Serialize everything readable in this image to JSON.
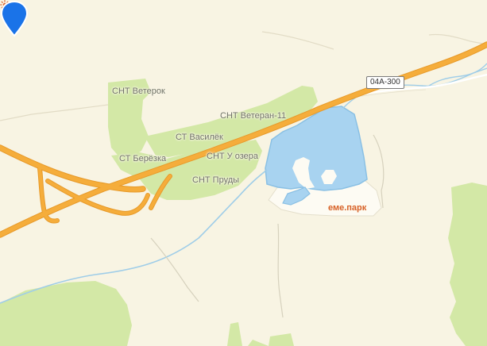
{
  "map": {
    "colors": {
      "land": "#f8f4e3",
      "forest": "#d3e8a6",
      "forest_dark": "#bedf8d",
      "water": "#a8d3f0",
      "water_stroke": "#8ac0e4",
      "stream": "#9fcde8",
      "highway": "#f5ad3b",
      "highway_casing": "#e79a2a",
      "minor_road": "#ffffff",
      "track": "#d6d1bd",
      "pin": "#1a73e8",
      "poi_accent": "#d8622a"
    },
    "road_shield": "04А-300",
    "labels": {
      "snt_veterok": "СНТ Ветерок",
      "snt_veteran": "СНТ Ветеран-11",
      "st_vasilek": "СТ Василёк",
      "st_berezka": "СТ Берёзка",
      "snt_u_ozera": "СНТ У озера",
      "snt_prudy": "СНТ Пруды"
    },
    "poi": {
      "name": "еме.парк",
      "icon": "sun-icon"
    },
    "marker": {
      "icon": "location-pin-icon"
    }
  }
}
